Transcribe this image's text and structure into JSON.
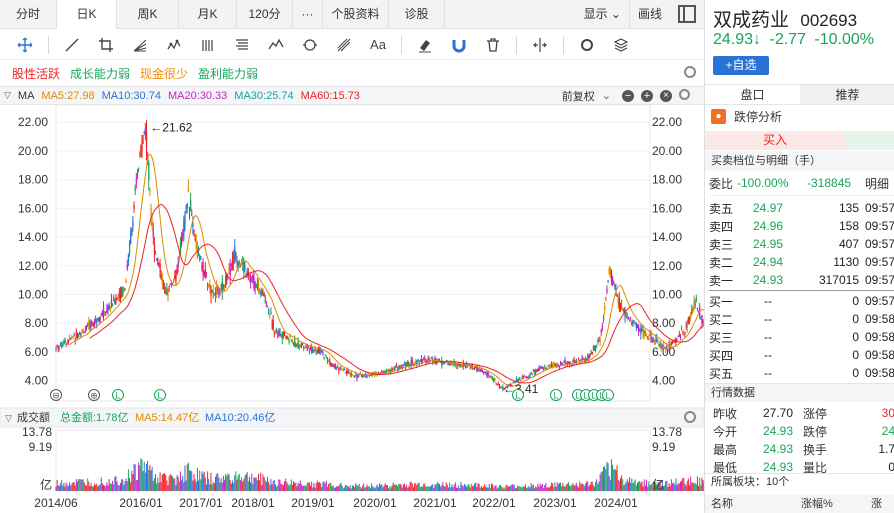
{
  "tabs": [
    {
      "label": "分时",
      "active": false
    },
    {
      "label": "日K",
      "active": true
    },
    {
      "label": "周K",
      "active": false
    },
    {
      "label": "月K",
      "active": false
    },
    {
      "label": "120分",
      "active": false
    },
    {
      "label": "···",
      "active": false
    },
    {
      "label": "个股资料",
      "active": false
    },
    {
      "label": "诊股",
      "active": false
    }
  ],
  "tabs_right": {
    "display": "显示",
    "draw": "画线"
  },
  "tools": [
    "crosshair-icon",
    "line-icon",
    "crop-icon",
    "fan-icon",
    "wave-icon",
    "bars-icon",
    "list-icon",
    "mountain-icon",
    "cycle-icon",
    "fork-icon",
    "text-icon",
    "eraser-icon",
    "magnet-icon",
    "trash-icon",
    "split-icon",
    "gear-icon",
    "layers-icon"
  ],
  "tools_text": {
    "text_tool": "Aa"
  },
  "tags": [
    {
      "label": "股性活跃",
      "color": "#e22"
    },
    {
      "label": "成长能力弱",
      "color": "#19a45a"
    },
    {
      "label": "现金很少",
      "color": "#f08c00"
    },
    {
      "label": "盈利能力弱",
      "color": "#19a45a"
    }
  ],
  "ma_bar": {
    "label": "MA",
    "items": [
      {
        "text": "MA5:27.98",
        "color": "#e08a00"
      },
      {
        "text": "MA10:30.74",
        "color": "#2a72d6"
      },
      {
        "text": "MA20:30.33",
        "color": "#c823c8"
      },
      {
        "text": "MA30:25.74",
        "color": "#19a0a0"
      },
      {
        "text": "MA60:15.73",
        "color": "#e22"
      }
    ],
    "adjust": "前复权"
  },
  "volume_bar": {
    "label": "成交额",
    "items": [
      {
        "text": "总金额:1.78亿",
        "color": "#19a45a"
      },
      {
        "text": "MA5:14.47亿",
        "color": "#e08a00"
      },
      {
        "text": "MA10:20.46亿",
        "color": "#2a72d6"
      }
    ]
  },
  "chart_data": {
    "type": "candlestick",
    "x_ticks": [
      "2014/06",
      "2016/01",
      "2017/01",
      "2018/01",
      "2019/01",
      "2020/01",
      "2021/01",
      "2022/01",
      "2023/01",
      "2024/01"
    ],
    "price_ticks": [
      "22.00",
      "20.00",
      "18.00",
      "16.00",
      "14.00",
      "12.00",
      "10.00",
      "8.00",
      "6.00",
      "4.00"
    ],
    "ylim": [
      3.0,
      22.5
    ],
    "price_path": [
      [
        0,
        6.3
      ],
      [
        0.5,
        7.5
      ],
      [
        0.9,
        9.0
      ],
      [
        1.2,
        10.5
      ],
      [
        1.45,
        19.5
      ],
      [
        1.55,
        21.62
      ],
      [
        1.7,
        13.5
      ],
      [
        1.9,
        10.0
      ],
      [
        2.1,
        11.5
      ],
      [
        2.3,
        17.0
      ],
      [
        2.45,
        13.0
      ],
      [
        2.7,
        10.0
      ],
      [
        2.9,
        10.5
      ],
      [
        3.1,
        12.8
      ],
      [
        3.4,
        11.0
      ],
      [
        3.6,
        10.0
      ],
      [
        3.8,
        7.5
      ],
      [
        4.2,
        6.5
      ],
      [
        4.6,
        6.0
      ],
      [
        4.8,
        5.0
      ],
      [
        5.2,
        4.3
      ],
      [
        5.6,
        4.5
      ],
      [
        6.0,
        5.0
      ],
      [
        6.4,
        5.5
      ],
      [
        6.8,
        5.2
      ],
      [
        7.2,
        5.0
      ],
      [
        7.5,
        4.4
      ],
      [
        7.75,
        3.41
      ],
      [
        8.0,
        4.0
      ],
      [
        8.4,
        4.8
      ],
      [
        8.8,
        5.2
      ],
      [
        9.2,
        5.5
      ],
      [
        9.45,
        7.0
      ],
      [
        9.6,
        11.8
      ],
      [
        9.75,
        9.5
      ],
      [
        10.0,
        8.0
      ],
      [
        10.3,
        7.0
      ],
      [
        10.6,
        6.2
      ],
      [
        10.9,
        7.5
      ],
      [
        11.1,
        9.5
      ],
      [
        11.3,
        7.0
      ],
      [
        11.5,
        5.5
      ],
      [
        11.75,
        4.5
      ]
    ],
    "high_label": "←21.62",
    "low_label": "←3.41",
    "vol_ticks": [
      "13.78",
      "9.19",
      "亿"
    ],
    "vol_unit": "亿",
    "markers": [
      "⊖",
      "⊕",
      "L",
      "L",
      "L",
      "L",
      "L",
      "L",
      "L",
      "L",
      "L"
    ]
  },
  "stock": {
    "name": "双成药业",
    "code": "002693",
    "price": "24.93↓",
    "change": "-2.77",
    "pct": "-10.00%",
    "add_btn": "+自选"
  },
  "right_tabs": {
    "tab1": "盘口",
    "tab2": "推荐"
  },
  "limit_analysis": "跌停分析",
  "buy_in": "买入",
  "orderbook_title": "买卖档位与明细（手）",
  "weibi": {
    "label": "委比",
    "pct": "-100.00%",
    "diff": "-318845",
    "detail": "明细"
  },
  "asks": [
    {
      "label": "卖五",
      "price": "24.97",
      "vol": "135",
      "time": "09:57"
    },
    {
      "label": "卖四",
      "price": "24.96",
      "vol": "158",
      "time": "09:57"
    },
    {
      "label": "卖三",
      "price": "24.95",
      "vol": "407",
      "time": "09:57"
    },
    {
      "label": "卖二",
      "price": "24.94",
      "vol": "1130",
      "time": "09:57"
    },
    {
      "label": "卖一",
      "price": "24.93",
      "vol": "317015",
      "time": "09:57"
    }
  ],
  "bids": [
    {
      "label": "买一",
      "price": "--",
      "vol": "0",
      "time": "09:57"
    },
    {
      "label": "买二",
      "price": "--",
      "vol": "0",
      "time": "09:58"
    },
    {
      "label": "买三",
      "price": "--",
      "vol": "0",
      "time": "09:58"
    },
    {
      "label": "买四",
      "price": "--",
      "vol": "0",
      "time": "09:58"
    },
    {
      "label": "买五",
      "price": "--",
      "vol": "0",
      "time": "09:58"
    }
  ],
  "quote_title": "行情数据",
  "quote": [
    {
      "l1": "昨收",
      "v1": "27.70",
      "l2": "涨停",
      "v2": "30"
    },
    {
      "l1": "今开",
      "v1": "24.93",
      "l2": "跌停",
      "v2": "24"
    },
    {
      "l1": "最高",
      "v1": "24.93",
      "l2": "换手",
      "v2": "1.7"
    },
    {
      "l1": "最低",
      "v1": "24.93",
      "l2": "量比",
      "v2": "0"
    }
  ],
  "sector": "所属板块：10个",
  "sector_cols": {
    "name": "名称",
    "chg": "涨幅%",
    "extra": "涨"
  }
}
